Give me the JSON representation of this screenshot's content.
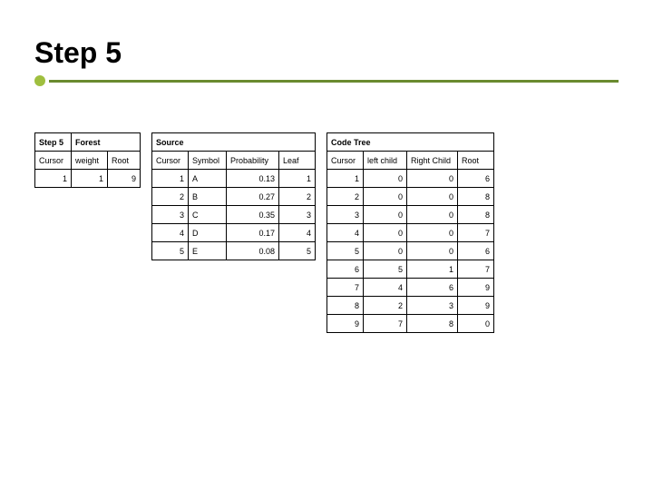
{
  "title": "Step 5",
  "step_label": "Step 5",
  "sections": {
    "forest": "Forest",
    "source": "Source",
    "code": "Code Tree"
  },
  "forest": {
    "headers": [
      "Cursor",
      "weight",
      "Root"
    ],
    "rows": [
      {
        "cursor": "1",
        "weight": "1",
        "root": "9"
      }
    ]
  },
  "source": {
    "headers": [
      "Cursor",
      "Symbol",
      "Probability",
      "Leaf"
    ],
    "rows": [
      {
        "cursor": "1",
        "symbol": "A",
        "prob": "0.13",
        "leaf": "1"
      },
      {
        "cursor": "2",
        "symbol": "B",
        "prob": "0.27",
        "leaf": "2"
      },
      {
        "cursor": "3",
        "symbol": "C",
        "prob": "0.35",
        "leaf": "3"
      },
      {
        "cursor": "4",
        "symbol": "D",
        "prob": "0.17",
        "leaf": "4"
      },
      {
        "cursor": "5",
        "symbol": "E",
        "prob": "0.08",
        "leaf": "5"
      }
    ]
  },
  "code": {
    "headers": [
      "Cursor",
      "left child",
      "Right Child",
      "Root"
    ],
    "rows": [
      {
        "cursor": "1",
        "left": "0",
        "right": "0",
        "root": "6"
      },
      {
        "cursor": "2",
        "left": "0",
        "right": "0",
        "root": "8"
      },
      {
        "cursor": "3",
        "left": "0",
        "right": "0",
        "root": "8"
      },
      {
        "cursor": "4",
        "left": "0",
        "right": "0",
        "root": "7"
      },
      {
        "cursor": "5",
        "left": "0",
        "right": "0",
        "root": "6"
      },
      {
        "cursor": "6",
        "left": "5",
        "right": "1",
        "root": "7"
      },
      {
        "cursor": "7",
        "left": "4",
        "right": "6",
        "root": "9"
      },
      {
        "cursor": "8",
        "left": "2",
        "right": "3",
        "root": "9"
      },
      {
        "cursor": "9",
        "left": "7",
        "right": "8",
        "root": "0"
      }
    ]
  }
}
